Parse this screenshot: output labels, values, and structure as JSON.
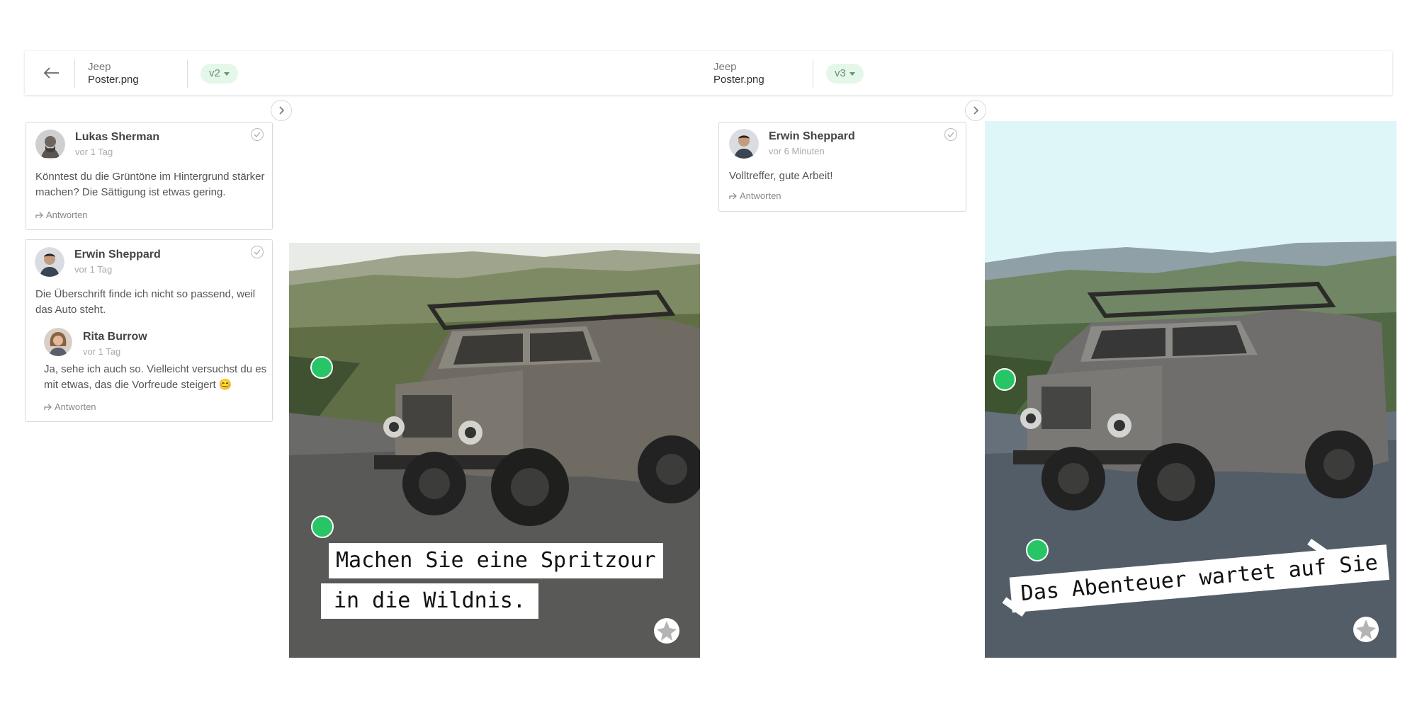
{
  "header": {
    "left": {
      "project": "Jeep",
      "file": "Poster.png",
      "version": "v2"
    },
    "right": {
      "project": "Jeep",
      "file": "Poster.png",
      "version": "v3"
    }
  },
  "left_comments": [
    {
      "author": "Lukas Sherman",
      "time": "vor 1 Tag",
      "text": "Könntest du die Grüntöne im Hintergrund stärker machen? Die Sättigung ist etwas gering.",
      "reply_label": "Antworten"
    },
    {
      "author": "Erwin Sheppard",
      "time": "vor 1 Tag",
      "text": "Die Überschrift finde ich nicht so passend, weil das Auto steht.",
      "reply": {
        "author": "Rita Burrow",
        "time": "vor 1 Tag",
        "text": "Ja, sehe ich auch so. Vielleicht versuchst du es mit etwas, das die Vorfreude steigert 😊"
      },
      "reply_label": "Antworten"
    }
  ],
  "right_comments": [
    {
      "author": "Erwin Sheppard",
      "time": "vor 6 Minuten",
      "text": "Volltreffer, gute Arbeit!",
      "reply_label": "Antworten"
    }
  ],
  "poster_v2": {
    "line1": "Machen Sie eine Spritzour",
    "line2": "in die Wildnis."
  },
  "poster_v3": {
    "headline": "Das Abenteuer wartet auf Sie"
  },
  "colors": {
    "pin": "#27c566",
    "version_badge": "#e4f7e9"
  }
}
